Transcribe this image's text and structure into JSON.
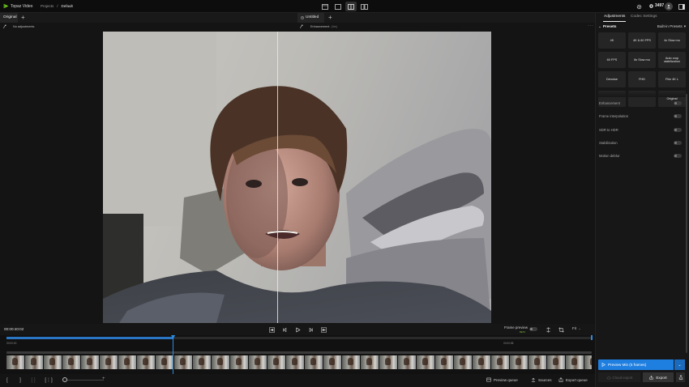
{
  "app": {
    "title": "Topaz Video"
  },
  "breadcrumb": {
    "project": "Projects",
    "separator": "/",
    "current": "Default"
  },
  "topbar": {
    "credits": "3497"
  },
  "tabs": {
    "left": {
      "label": "Original"
    },
    "right": {
      "label": "Untitled"
    }
  },
  "viewer": {
    "left_status": "No adjustments",
    "right_status": "Enhancement",
    "right_model": "(Iris)"
  },
  "transport": {
    "timecode": "00:00:40:02",
    "frame_preview_label": "Frame preview",
    "frame_preview_badge": "BETA",
    "fit_label": "Fit"
  },
  "timeline": {
    "start_stamp": "00:00:00",
    "end_stamp": "00:00:58",
    "playhead_fraction": 0.284
  },
  "bottombar": {
    "preview_queue": "Preview queue",
    "sources": "Sources",
    "export_queue": "Export queue"
  },
  "panel": {
    "tabs": {
      "adjustments": "Adjustments",
      "codec": "Codec Settings"
    },
    "presets_title": "Presets",
    "presets_source": "Built-in Presets",
    "presets": [
      "4K",
      "4K & 60 FPS",
      "4x Slow mo",
      "60 FPS",
      "8x Slow mo",
      "Auto crop stabilization",
      "Denoise",
      "FHD",
      "Film 4K L",
      "",
      "",
      "Original"
    ],
    "toggles": [
      {
        "label": "Enhancement",
        "on": false
      },
      {
        "label": "Frame interpolation",
        "on": false
      },
      {
        "label": "SDR to HDR",
        "on": false
      },
      {
        "label": "Stabilization",
        "on": false
      },
      {
        "label": "Motion deblur",
        "on": false
      }
    ],
    "preview_button": "Preview Min (5 frames)",
    "cloud_button": "Cloud export",
    "export_button": "Export"
  },
  "colors": {
    "accent": "#1f7fe0",
    "logo": "#7ed321",
    "beta": "#7fbf3f"
  }
}
